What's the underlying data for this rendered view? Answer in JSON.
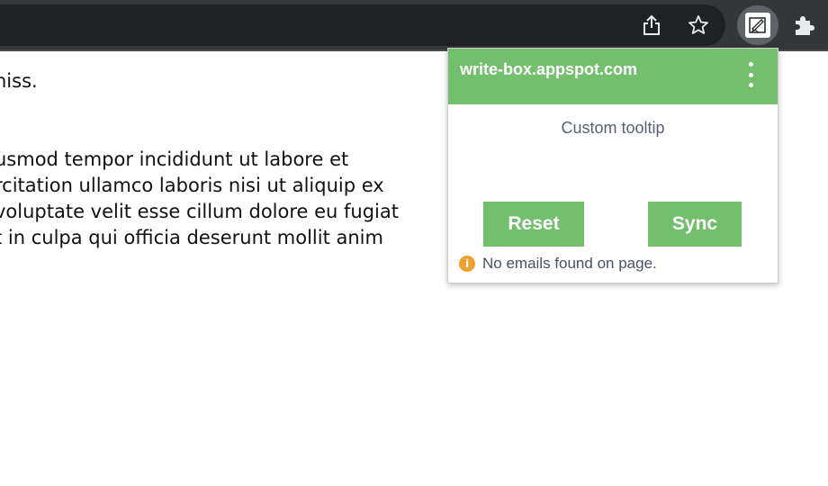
{
  "browser": {
    "icons": {
      "share": "share-icon",
      "bookmark": "star-icon",
      "extension": "write-box-extension-icon",
      "extensions_menu": "puzzle-icon"
    }
  },
  "page": {
    "lines": [
      "niss.",
      "usmod tempor incididunt ut labore et",
      "rcitation ullamco laboris nisi ut aliquip ex",
      "voluptate velit esse cillum dolore eu fugiat",
      "t in culpa qui officia deserunt mollit anim"
    ]
  },
  "popup": {
    "title": "write-box.appspot.com",
    "tooltip": "Custom tooltip",
    "reset_label": "Reset",
    "sync_label": "Sync",
    "status_text": "No emails found on page.",
    "info_glyph": "i",
    "colors": {
      "accent": "#73bf6e",
      "info": "#f0a030"
    }
  }
}
